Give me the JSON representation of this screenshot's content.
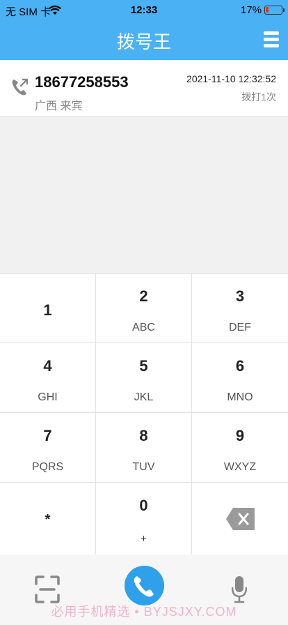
{
  "status": {
    "carrier": "无 SIM 卡",
    "time": "12:33",
    "battery_percent": "17%",
    "battery_level": 0.17
  },
  "header": {
    "title": "拨号王"
  },
  "history": [
    {
      "number": "18677258553",
      "location": "广西 来宾",
      "datetime": "2021-11-10 12:32:52",
      "count": "拨打1次"
    }
  ],
  "keypad": [
    {
      "digit": "1",
      "letters": ""
    },
    {
      "digit": "2",
      "letters": "ABC"
    },
    {
      "digit": "3",
      "letters": "DEF"
    },
    {
      "digit": "4",
      "letters": "GHI"
    },
    {
      "digit": "5",
      "letters": "JKL"
    },
    {
      "digit": "6",
      "letters": "MNO"
    },
    {
      "digit": "7",
      "letters": "PQRS"
    },
    {
      "digit": "8",
      "letters": "TUV"
    },
    {
      "digit": "9",
      "letters": "WXYZ"
    },
    {
      "digit": "*",
      "letters": ""
    },
    {
      "digit": "0",
      "letters": "+"
    }
  ],
  "bottom": {
    "watermark": "必用手机精选 • BYJSJXY.COM"
  },
  "colors": {
    "header": "#49b1f4",
    "call_button": "#2fa0ea",
    "battery_low": "#e53030"
  },
  "icons": [
    "wifi-icon",
    "battery-icon",
    "menu-icon",
    "outgoing-call-icon",
    "backspace-icon",
    "scan-icon",
    "phone-icon",
    "microphone-icon"
  ]
}
